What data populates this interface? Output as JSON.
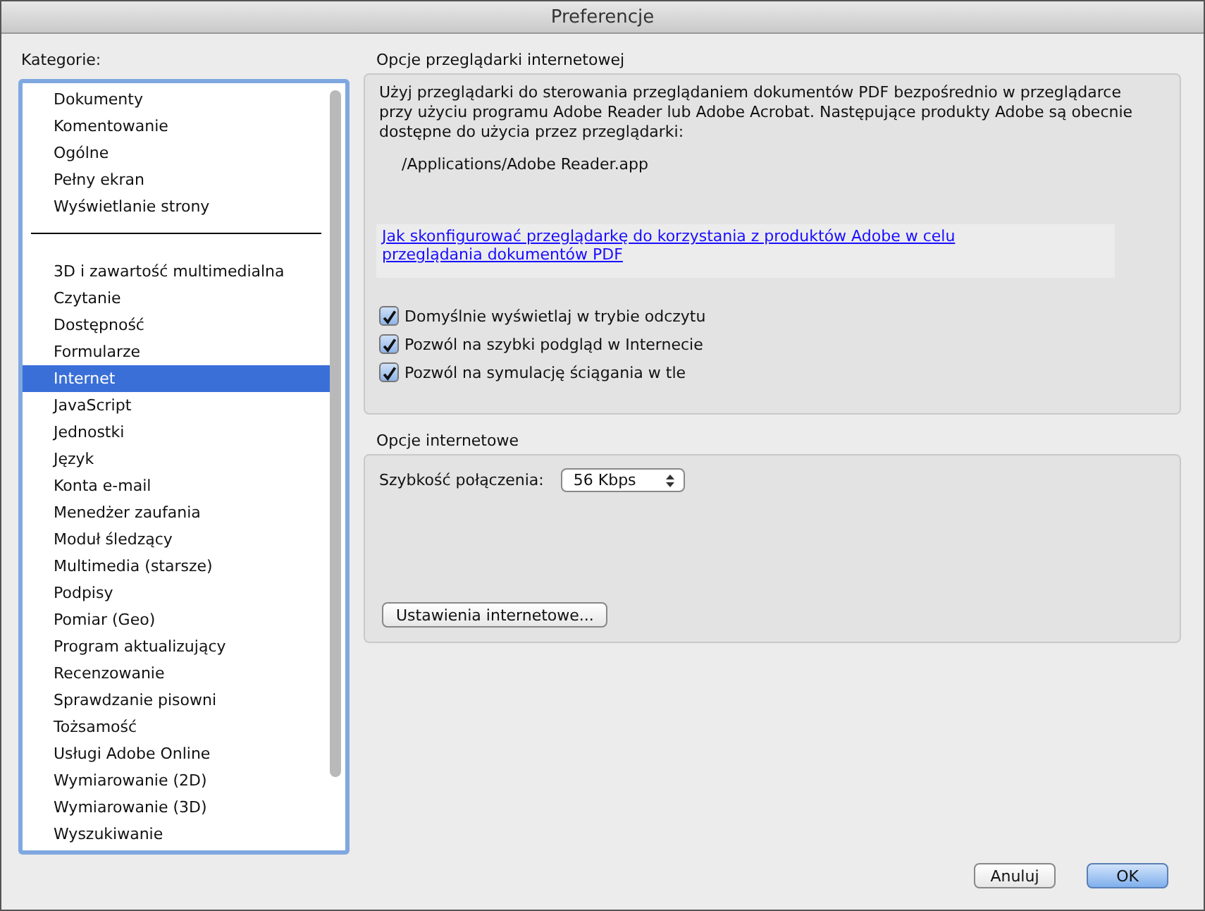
{
  "window": {
    "title": "Preferencje"
  },
  "categories": {
    "label": "Kategorie:",
    "groups": [
      {
        "items": [
          {
            "label": "Dokumenty",
            "selected": false
          },
          {
            "label": "Komentowanie",
            "selected": false
          },
          {
            "label": "Ogólne",
            "selected": false
          },
          {
            "label": "Pełny ekran",
            "selected": false
          },
          {
            "label": "Wyświetlanie strony",
            "selected": false
          }
        ]
      },
      {
        "items": [
          {
            "label": "3D i zawartość multimedialna",
            "selected": false
          },
          {
            "label": "Czytanie",
            "selected": false
          },
          {
            "label": "Dostępność",
            "selected": false
          },
          {
            "label": "Formularze",
            "selected": false
          },
          {
            "label": "Internet",
            "selected": true
          },
          {
            "label": "JavaScript",
            "selected": false
          },
          {
            "label": "Jednostki",
            "selected": false
          },
          {
            "label": "Język",
            "selected": false
          },
          {
            "label": "Konta e-mail",
            "selected": false
          },
          {
            "label": "Menedżer zaufania",
            "selected": false
          },
          {
            "label": "Moduł śledzący",
            "selected": false
          },
          {
            "label": "Multimedia (starsze)",
            "selected": false
          },
          {
            "label": "Podpisy",
            "selected": false
          },
          {
            "label": "Pomiar (Geo)",
            "selected": false
          },
          {
            "label": "Program aktualizujący",
            "selected": false
          },
          {
            "label": "Recenzowanie",
            "selected": false
          },
          {
            "label": "Sprawdzanie pisowni",
            "selected": false
          },
          {
            "label": "Tożsamość",
            "selected": false
          },
          {
            "label": "Usługi Adobe Online",
            "selected": false
          },
          {
            "label": "Wymiarowanie (2D)",
            "selected": false
          },
          {
            "label": "Wymiarowanie (3D)",
            "selected": false
          },
          {
            "label": "Wyszukiwanie",
            "selected": false
          }
        ]
      }
    ]
  },
  "browser_options": {
    "title": "Opcje przeglądarki internetowej",
    "description": "Użyj przeglądarki do sterowania przeglądaniem dokumentów PDF bezpośrednio w przeglądarce przy użyciu programu Adobe Reader lub Adobe Acrobat. Następujące produkty Adobe są obecnie dostępne do użycia przez przeglądarki:",
    "path": "/Applications/Adobe Reader.app",
    "link": "Jak skonfigurować przeglądarkę do korzystania z produktów Adobe w celu przeglądania dokumentów PDF",
    "checkboxes": [
      {
        "label": "Domyślnie wyświetlaj w trybie odczytu",
        "checked": true
      },
      {
        "label": "Pozwól na szybki podgląd w Internecie",
        "checked": true
      },
      {
        "label": "Pozwól na symulację ściągania w tle",
        "checked": true
      }
    ]
  },
  "internet_options": {
    "title": "Opcje internetowe",
    "speed_label": "Szybkość połączenia:",
    "speed_value": "56 Kbps",
    "settings_button": "Ustawienia internetowe..."
  },
  "buttons": [
    {
      "label": "Anuluj",
      "default": false
    },
    {
      "label": "OK",
      "default": true
    }
  ]
}
